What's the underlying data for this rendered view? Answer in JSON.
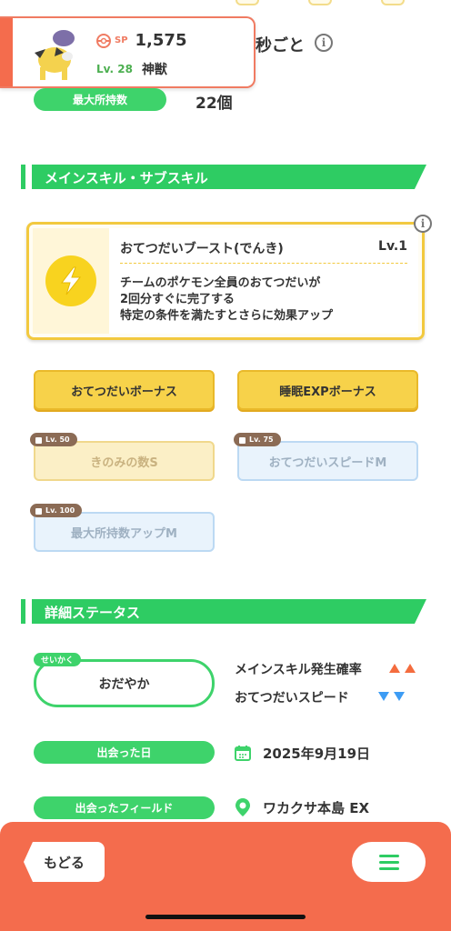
{
  "header": {
    "sp_label": "SP",
    "sp_value": "1,575",
    "level": "Lv. 28",
    "nickname": "神獣",
    "per_seconds_suffix": "秒ごと"
  },
  "max_carry": {
    "label": "最大所持数",
    "value": "22個"
  },
  "skills_section": {
    "title": "メインスキル・サブスキル"
  },
  "main_skill": {
    "name": "おてつだいブースト(でんき)",
    "level": "Lv.1",
    "description": [
      "チームのポケモン全員のおてつだいが",
      "2回分すぐに完了する",
      "特定の条件を満たすとさらに効果アップ"
    ]
  },
  "sub_skills": [
    {
      "label": "おてつだいボーナス",
      "lock": ""
    },
    {
      "label": "睡眠EXPボーナス",
      "lock": ""
    },
    {
      "label": "きのみの数S",
      "lock": "Lv. 50"
    },
    {
      "label": "おてつだいスピードM",
      "lock": "Lv. 75"
    },
    {
      "label": "最大所持数アップM",
      "lock": "Lv. 100"
    }
  ],
  "details_section": {
    "title": "詳細ステータス"
  },
  "nature": {
    "tag": "せいかく",
    "value": "おだやか",
    "up_stat": "メインスキル発生確率",
    "down_stat": "おてつだいスピード"
  },
  "met_date": {
    "label": "出会った日",
    "value": "2025年9月19日"
  },
  "met_field": {
    "label": "出会ったフィールド",
    "value": "ワカクサ本島 EX"
  },
  "bottom": {
    "back_label": "もどる"
  },
  "colors": {
    "accent_green": "#3ed36b",
    "bottom_bar": "#f46c4d",
    "skill_gold": "#f7d24a"
  }
}
